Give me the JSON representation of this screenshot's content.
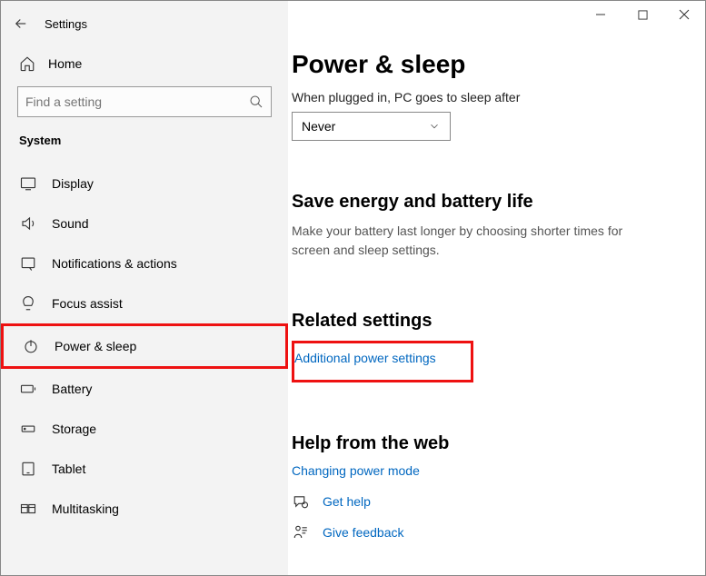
{
  "window": {
    "title": "Settings"
  },
  "sidebar": {
    "home": "Home",
    "search_placeholder": "Find a setting",
    "category": "System",
    "items": [
      {
        "label": "Display"
      },
      {
        "label": "Sound"
      },
      {
        "label": "Notifications & actions"
      },
      {
        "label": "Focus assist"
      },
      {
        "label": "Power & sleep"
      },
      {
        "label": "Battery"
      },
      {
        "label": "Storage"
      },
      {
        "label": "Tablet"
      },
      {
        "label": "Multitasking"
      }
    ]
  },
  "main": {
    "title": "Power & sleep",
    "sleep_label": "When plugged in, PC goes to sleep after",
    "sleep_value": "Never",
    "section_energy_title": "Save energy and battery life",
    "section_energy_body": "Make your battery last longer by choosing shorter times for screen and sleep settings.",
    "section_related_title": "Related settings",
    "link_additional": "Additional power settings",
    "section_help_title": "Help from the web",
    "link_changing": "Changing power mode",
    "link_gethelp": "Get help",
    "link_feedback": "Give feedback"
  }
}
